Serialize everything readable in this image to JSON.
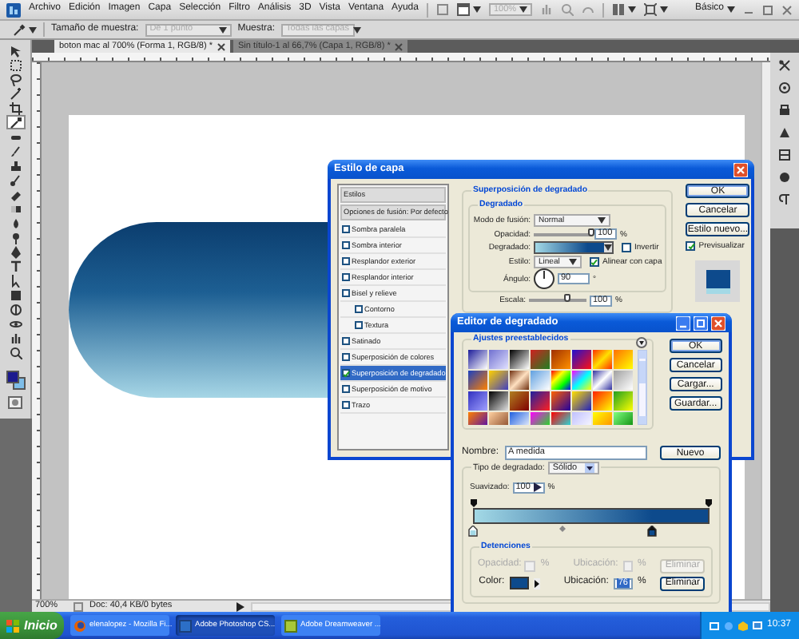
{
  "menu_bar": {
    "items": [
      "Archivo",
      "Edición",
      "Imagen",
      "Capa",
      "Selección",
      "Filtro",
      "Análisis",
      "3D",
      "Vista",
      "Ventana",
      "Ayuda"
    ],
    "zoom": "100%",
    "workspace": "Básico"
  },
  "options_bar": {
    "sample_size_label": "Tamaño de muestra:",
    "sample_size": "De 1 punto",
    "sample_label": "Muestra:",
    "sample": "Todas las capas"
  },
  "document_tabs": [
    {
      "label": "boton mac al 700% (Forma 1, RGB/8) *",
      "selected": true
    },
    {
      "label": "Sin título-1 al 66,7% (Capa 1, RGB/8) *",
      "selected": false
    }
  ],
  "tools": [
    {
      "kind": "move",
      "selected": false
    },
    {
      "kind": "marquee",
      "selected": false
    },
    {
      "kind": "lasso",
      "selected": false
    },
    {
      "kind": "wand",
      "selected": false
    },
    {
      "kind": "crop",
      "selected": false
    },
    {
      "kind": "eyedropper",
      "selected": true
    },
    {
      "kind": "heal",
      "selected": false
    },
    {
      "kind": "brush",
      "selected": false
    },
    {
      "kind": "stamp",
      "selected": false
    },
    {
      "kind": "history",
      "selected": false
    },
    {
      "kind": "eraser",
      "selected": false
    },
    {
      "kind": "gradient",
      "selected": false
    },
    {
      "kind": "blur",
      "selected": false
    },
    {
      "kind": "dodge",
      "selected": false
    },
    {
      "kind": "pen",
      "selected": false
    },
    {
      "kind": "type",
      "selected": false
    },
    {
      "kind": "select",
      "selected": false
    },
    {
      "kind": "shape",
      "selected": false
    },
    {
      "kind": "rotate",
      "selected": false
    },
    {
      "kind": "orbit",
      "selected": false
    },
    {
      "kind": "hand",
      "selected": false
    },
    {
      "kind": "zoom",
      "selected": false
    }
  ],
  "color_swatches": [
    {
      "kind": "foreground",
      "color": "#1c1a8e"
    },
    {
      "kind": "background",
      "color": "#7ebde8"
    }
  ],
  "status_bar": {
    "zoom": "700%",
    "document_info": "Doc: 40,4 KB/0 bytes"
  },
  "layer_style": {
    "title": "Estilo de capa",
    "styles": [
      {
        "label": "Estilos",
        "kind": "header",
        "selected": false
      },
      {
        "label": "Opciones de fusión: Por defecto",
        "kind": "header",
        "selected": false
      },
      {
        "label": "Sombra paralela",
        "kind": "effect",
        "checked": false,
        "selected": false
      },
      {
        "label": "Sombra interior",
        "kind": "effect",
        "checked": false,
        "selected": false
      },
      {
        "label": "Resplandor exterior",
        "kind": "effect",
        "checked": false,
        "selected": false
      },
      {
        "label": "Resplandor interior",
        "kind": "effect",
        "checked": false,
        "selected": false
      },
      {
        "label": "Bisel y relieve",
        "kind": "effect",
        "checked": false,
        "selected": false,
        "children": [
          {
            "label": "Contorno",
            "kind": "effect",
            "checked": false,
            "selected": false
          },
          {
            "label": "Textura",
            "kind": "effect",
            "checked": false,
            "selected": false
          }
        ]
      },
      {
        "label": "Satinado",
        "kind": "effect",
        "checked": false,
        "selected": false
      },
      {
        "label": "Superposición de colores",
        "kind": "effect",
        "checked": false,
        "selected": false
      },
      {
        "label": "Superposición de degradado",
        "kind": "effect",
        "checked": true,
        "selected": true
      },
      {
        "label": "Superposición de motivo",
        "kind": "effect",
        "checked": false,
        "selected": false
      },
      {
        "label": "Trazo",
        "kind": "effect",
        "checked": false,
        "selected": false
      }
    ],
    "section_title": "Superposición de degradado",
    "group_title": "Degradado",
    "blend_mode": {
      "label": "Modo de fusión:",
      "value": "Normal"
    },
    "opacity": {
      "label": "Opacidad:",
      "value": "100",
      "unit": "%",
      "level": 1
    },
    "gradient": {
      "label": "Degradado:"
    },
    "reverse": {
      "label": "Invertir",
      "checked": false
    },
    "style": {
      "label": "Estilo:",
      "value": "Lineal"
    },
    "align": {
      "label": "Alinear con capa",
      "checked": true
    },
    "angle": {
      "label": "Ángulo:",
      "value": "90",
      "unit": "°"
    },
    "scale": {
      "label": "Escala:",
      "value": "100",
      "unit": "%",
      "level": 0.66
    },
    "buttons": [
      "OK",
      "Cancelar",
      "Estilo nuevo..."
    ],
    "preview": {
      "label": "Previsualizar",
      "checked": true
    }
  },
  "gradient_editor": {
    "title": "Editor de degradado",
    "presets_title": "Ajustes preestablecidos",
    "buttons": [
      "OK",
      "Cancelar",
      "Cargar...",
      "Guardar..."
    ],
    "name_label": "Nombre:",
    "name": "A medida",
    "new_button": "Nuevo",
    "type_label": "Tipo de degradado:",
    "type": "Sólido",
    "smoothness_label": "Suavizado:",
    "smoothness": "100",
    "smoothness_unit": "%",
    "color_stops": [
      {
        "color": "#a3d9e6",
        "level": 0,
        "selected": false
      },
      {
        "color": "#0d4a8c",
        "level": 0.76,
        "selected": true
      }
    ],
    "stops_title": "Detenciones",
    "opacity_row": {
      "label": "Opacidad:",
      "unit": "%",
      "location_label": "Ubicación:",
      "location_unit": "%",
      "delete": "Eliminar",
      "disabled": true
    },
    "color_row": {
      "label": "Color:",
      "location_label": "Ubicación:",
      "location": "76",
      "location_unit": "%",
      "delete": "Eliminar",
      "disabled": false
    }
  },
  "taskbar": {
    "start": "Inicio",
    "tasks": [
      {
        "label": "elenalopez - Mozilla Fi...",
        "kind": "browser",
        "selected": false
      },
      {
        "label": "Adobe Photoshop CS...",
        "kind": "photoshop",
        "selected": true
      },
      {
        "label": "Adobe Dreamweaver ...",
        "kind": "dreamweaver",
        "selected": false
      }
    ],
    "clock": "10:37"
  }
}
